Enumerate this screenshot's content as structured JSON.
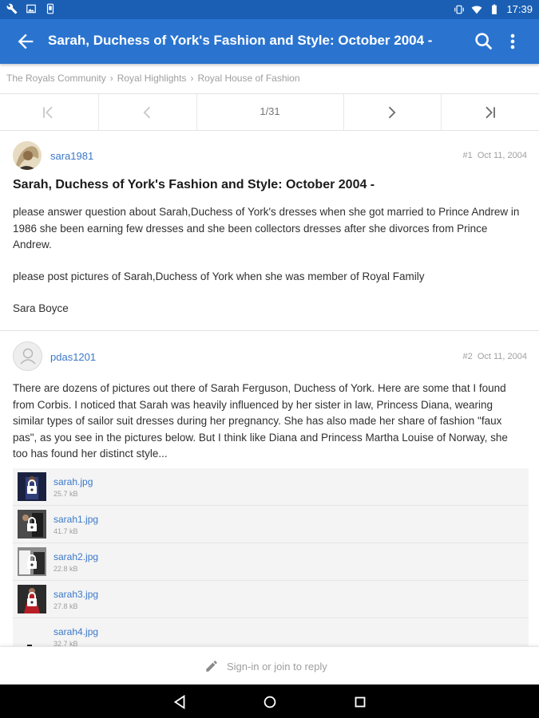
{
  "status_bar": {
    "time": "17:39",
    "left_icons": [
      "wrench-icon",
      "image-icon",
      "phone-icon"
    ],
    "right_icons": [
      "vibrate-icon",
      "wifi-icon",
      "battery-icon"
    ]
  },
  "app_bar": {
    "title": "Sarah, Duchess of York's Fashion and Style: October 2004 -",
    "color": "#2a74d0"
  },
  "breadcrumb": [
    "The Royals Community",
    "Royal Highlights",
    "Royal House of Fashion"
  ],
  "pager": {
    "page_label": "1/31"
  },
  "posts": [
    {
      "username": "sara1981",
      "number": "#1",
      "date": "Oct 11, 2004",
      "title": "Sarah, Duchess of York's Fashion and Style: October 2004 -",
      "paragraphs": [
        "please answer question about Sarah,Duchess of York's dresses when she got married to Prince Andrew in 1986 she been earning few dresses and she been collectors dresses after she divorces from Prince Andrew.",
        "please post pictures of Sarah,Duchess of York when she was member of Royal Family",
        "Sara Boyce"
      ]
    },
    {
      "username": "pdas1201",
      "number": "#2",
      "date": "Oct 11, 2004",
      "paragraphs": [
        "There are dozens of pictures out there of Sarah Ferguson, Duchess of York. Here are some that I found from Corbis. I noticed that Sarah was heavily influenced by her sister in law, Princess Diana, wearing similar types of sailor suit dresses during her pregnancy. She has also made her share of fashion \"faux pas\", as you see in the pictures below. But I think like Diana and Princess Martha Louise of Norway, she too has found her distinct style..."
      ],
      "attachments": [
        {
          "name": "sarah.jpg",
          "size": "25.7 kB"
        },
        {
          "name": "sarah1.jpg",
          "size": "41.7 kB"
        },
        {
          "name": "sarah2.jpg",
          "size": "22.8 kB"
        },
        {
          "name": "sarah3.jpg",
          "size": "27.8 kB"
        },
        {
          "name": "sarah4.jpg",
          "size": "32.7 kB"
        }
      ]
    }
  ],
  "reply_bar": {
    "label": "Sign-in or join to reply"
  }
}
